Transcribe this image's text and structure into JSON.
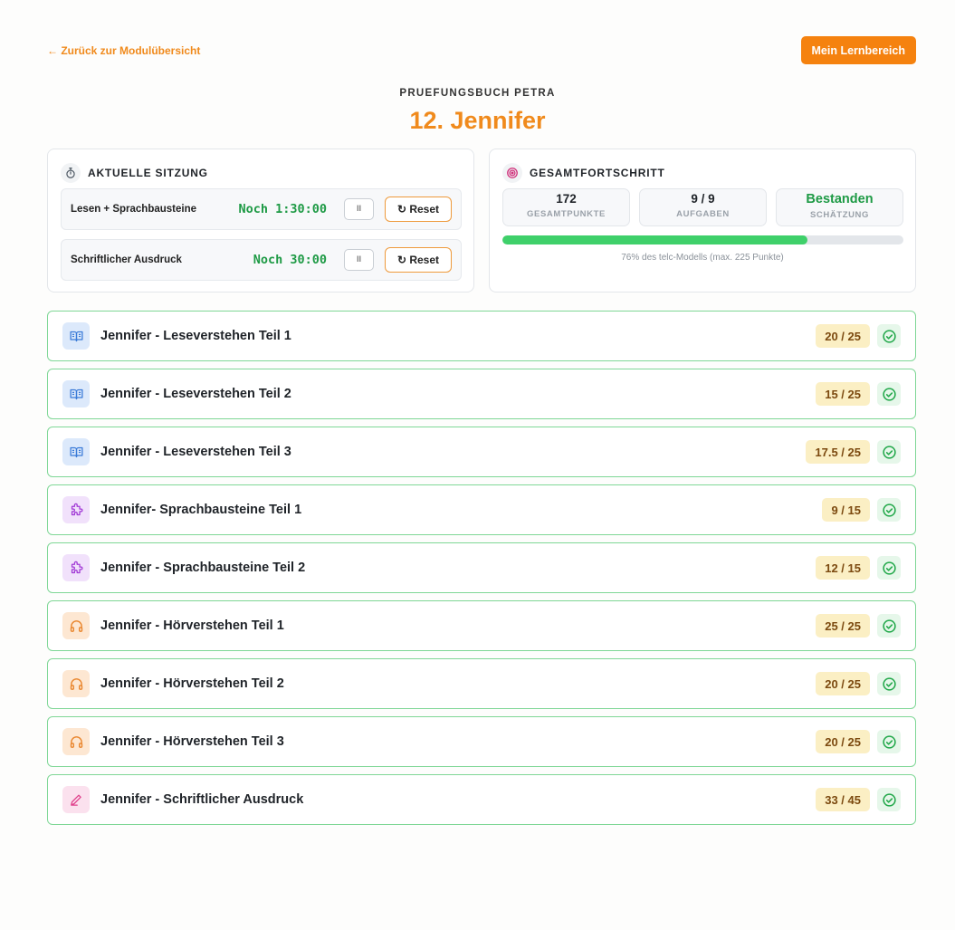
{
  "nav": {
    "back_label": "← Zurück zur Modulübersicht",
    "my_area_label": "Mein Lernbereich"
  },
  "header": {
    "overline": "PRUEFUNGSBUCH PETRA",
    "title": "12. Jennifer"
  },
  "session": {
    "heading": "AKTUELLE SITZUNG",
    "icon": "stopwatch-icon",
    "rows": [
      {
        "name": "Lesen + Sprachbausteine",
        "timer": "Noch 1:30:00",
        "pause_label": "II",
        "reset_label": "↻ Reset"
      },
      {
        "name": "Schriftlicher Ausdruck",
        "timer": "Noch 30:00",
        "pause_label": "II",
        "reset_label": "↻ Reset"
      }
    ]
  },
  "progress": {
    "heading": "GESAMTFORTSCHRITT",
    "icon": "target-icon",
    "stats": [
      {
        "value": "172",
        "label": "GESAMTPUNKTE"
      },
      {
        "value": "9 / 9",
        "label": "AUFGABEN"
      },
      {
        "value": "Bestanden",
        "label": "SCHÄTZUNG"
      }
    ],
    "percent": 76,
    "caption": "76% des telc-Modells (max. 225 Punkte)",
    "colors": {
      "fill": "#3fd06a",
      "track": "#e3e6ea",
      "pass": "#1e9a45"
    }
  },
  "modules": [
    {
      "title": "Jennifer - Leseverstehen Teil 1",
      "score": "20 / 25",
      "icon": "book-icon",
      "status": "completed"
    },
    {
      "title": "Jennifer - Leseverstehen Teil 2",
      "score": "15 / 25",
      "icon": "book-icon",
      "status": "completed"
    },
    {
      "title": "Jennifer - Leseverstehen Teil 3",
      "score": "17.5 / 25",
      "icon": "book-icon",
      "status": "completed"
    },
    {
      "title": "Jennifer- Sprachbausteine Teil 1",
      "score": "9 / 15",
      "icon": "puzzle-icon",
      "status": "completed"
    },
    {
      "title": "Jennifer - Sprachbausteine Teil 2",
      "score": "12 / 15",
      "icon": "puzzle-icon",
      "status": "completed"
    },
    {
      "title": "Jennifer - Hörverstehen Teil 1",
      "score": "25 / 25",
      "icon": "headphones-icon",
      "status": "completed"
    },
    {
      "title": "Jennifer - Hörverstehen Teil 2",
      "score": "20 / 25",
      "icon": "headphones-icon",
      "status": "completed"
    },
    {
      "title": "Jennifer - Hörverstehen Teil 3",
      "score": "20 / 25",
      "icon": "headphones-icon",
      "status": "completed"
    },
    {
      "title": "Jennifer - Schriftlicher Ausdruck",
      "score": "33 / 45",
      "icon": "pen-icon",
      "status": "completed"
    }
  ]
}
